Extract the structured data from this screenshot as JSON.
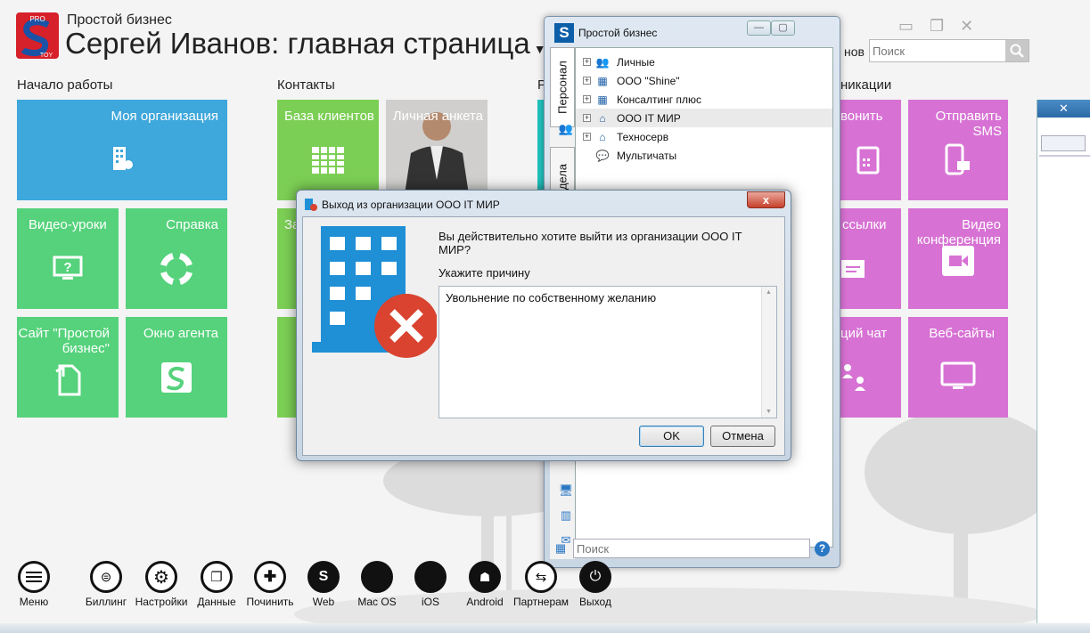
{
  "header": {
    "app_name": "Простой бизнес",
    "page_title": "Сергей Иванов: главная страница",
    "search_placeholder": "Поиск",
    "partial_text": "нов",
    "logo_top": "PRO",
    "logo_bottom": "TOY"
  },
  "sections": {
    "start": "Начало работы",
    "contacts": "Контакты",
    "partial": "Р",
    "comms_partial": "никации"
  },
  "tiles": {
    "my_org": "Моя организация",
    "video_lessons": "Видео-уроки",
    "help": "Справка",
    "site": "Сайт \"Простой бизнес\"",
    "agent_window": "Окно агента",
    "clients_base": "База клиентов",
    "personal_form": "Личная анкета",
    "partial_za": "За",
    "call_partial": "вонить",
    "send_sms": "Отправить SMS",
    "mailing_partial": "ссылки",
    "video_conf": "Видео конференция",
    "chat_partial": "ций чат",
    "websites": "Веб-сайты"
  },
  "toolbar": [
    {
      "label": "Меню",
      "icon": "menu-icon"
    },
    {
      "label": "Биллинг",
      "icon": "billing-icon"
    },
    {
      "label": "Настройки",
      "icon": "gear-icon"
    },
    {
      "label": "Данные",
      "icon": "windows-icon"
    },
    {
      "label": "Починить",
      "icon": "first-aid-icon"
    },
    {
      "label": "Web",
      "icon": "web-icon"
    },
    {
      "label": "Mac OS",
      "icon": "apple-icon"
    },
    {
      "label": "iOS",
      "icon": "apple-ios-icon"
    },
    {
      "label": "Android",
      "icon": "android-icon"
    },
    {
      "label": "Партнерам",
      "icon": "handshake-icon"
    },
    {
      "label": "Выход",
      "icon": "power-icon"
    }
  ],
  "tree_window": {
    "title": "Простой бизнес",
    "tab_personal": "Персонал",
    "tab_cases": "и дела",
    "items": [
      {
        "label": "Личные"
      },
      {
        "label": "ООО \"Shine\""
      },
      {
        "label": "Консалтинг плюс"
      },
      {
        "label": "ООО IT МИР"
      },
      {
        "label": "Техносерв"
      },
      {
        "label": "Мультичаты"
      }
    ],
    "search_placeholder": "Поиск",
    "help": "?"
  },
  "dialog": {
    "title": "Выход из организации ООО IT МИР",
    "question": "Вы действительно хотите выйти из организации ООО IT МИР?",
    "reason_label": "Укажите причину",
    "reason_value": "Увольнение по собственному желанию",
    "ok_label": "OK",
    "cancel_label": "Отмена",
    "close": "x"
  },
  "colors": {
    "blue_tile": "#3ea7db",
    "green_tile": "#55d27b",
    "pink_tile": "#d772d4",
    "teal_tile": "#22c4c0",
    "error_red": "#d9432f",
    "building_blue": "#1f8fd6"
  }
}
